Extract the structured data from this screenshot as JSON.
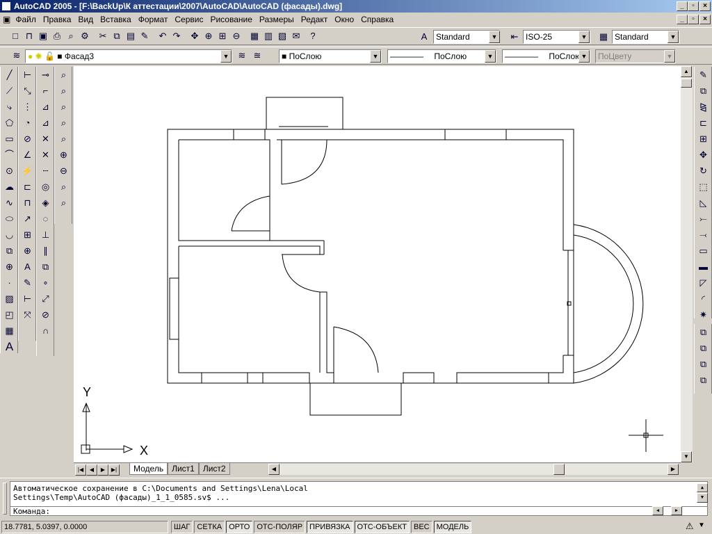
{
  "window": {
    "title": "AutoCAD 2005 - [F:\\BackUp\\К аттестации\\2007\\AutoCAD\\AutoCAD (фасады).dwg]"
  },
  "menu": [
    "Файл",
    "Правка",
    "Вид",
    "Вставка",
    "Формат",
    "Сервис",
    "Рисование",
    "Размеры",
    "Редакт",
    "Окно",
    "Справка"
  ],
  "styles": {
    "text_style": "Standard",
    "dim_style": "ISO-25",
    "table_style": "Standard"
  },
  "layers": {
    "current_layer": "Фасад3",
    "color": "ПоСлою",
    "linetype": "ПоСлою",
    "lineweight": "ПоСлою",
    "plotstyle": "ПоЦвету"
  },
  "axes": {
    "y": "Y",
    "x": "X"
  },
  "tabs": [
    "Модель",
    "Лист1",
    "Лист2"
  ],
  "command": {
    "line1": "Автоматическое сохранение в C:\\Documents and Settings\\Lena\\Local",
    "line2": "Settings\\Temp\\AutoCAD (фасады)_1_1_0585.sv$ ...",
    "prompt": "Команда:"
  },
  "status": {
    "coords": "18.7781, 5.0397, 0.0000",
    "toggles": [
      {
        "label": "ШАГ",
        "on": false
      },
      {
        "label": "СЕТКА",
        "on": false
      },
      {
        "label": "ОРТО",
        "on": true
      },
      {
        "label": "ОТС-ПОЛЯР",
        "on": false
      },
      {
        "label": "ПРИВЯЗКА",
        "on": true
      },
      {
        "label": "ОТС-ОБЪЕКТ",
        "on": true
      },
      {
        "label": "ВЕС",
        "on": false
      },
      {
        "label": "МОДЕЛЬ",
        "on": true
      }
    ]
  }
}
